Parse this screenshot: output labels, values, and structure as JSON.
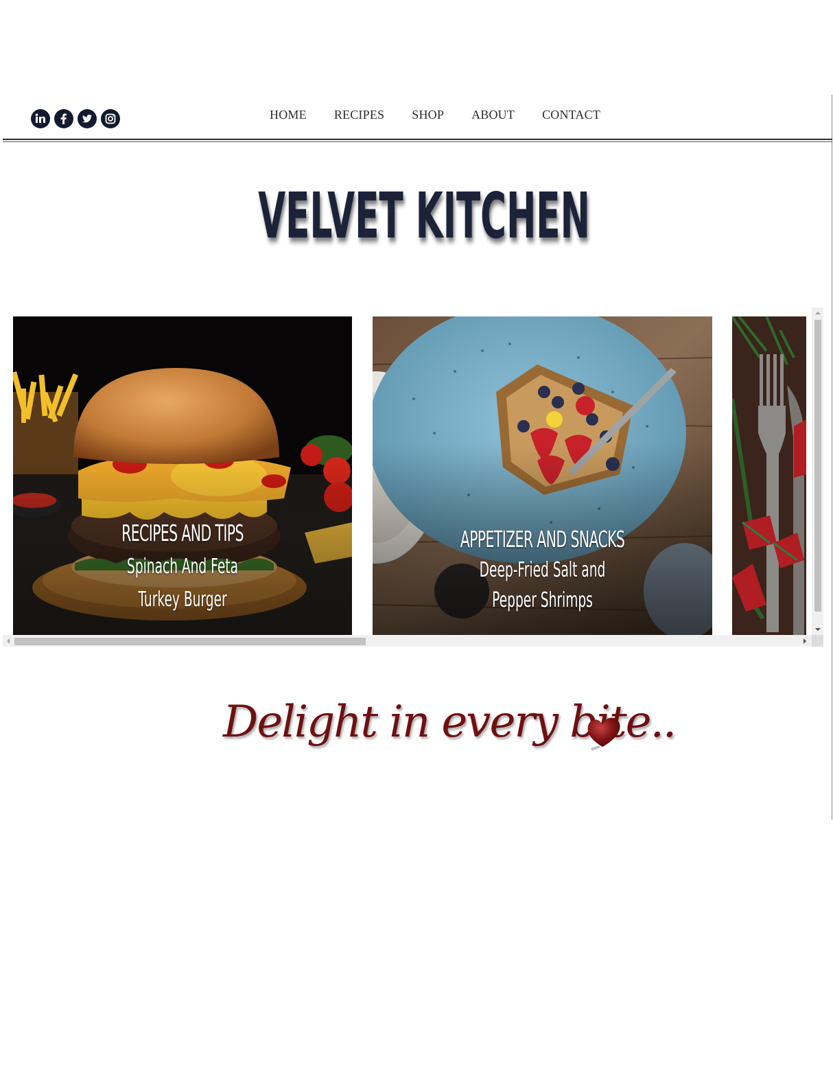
{
  "social": {
    "items": [
      {
        "name": "linkedin",
        "icon": "linkedin-icon"
      },
      {
        "name": "facebook",
        "icon": "facebook-icon"
      },
      {
        "name": "twitter",
        "icon": "twitter-icon"
      },
      {
        "name": "instagram",
        "icon": "instagram-icon"
      }
    ],
    "color": "#111a2e"
  },
  "nav": {
    "items": [
      "HOME",
      "RECIPES",
      "SHOP",
      "ABOUT",
      "CONTACT"
    ]
  },
  "logo": {
    "text": "VELVET KITCHEN",
    "color": "#1a2038"
  },
  "carousel": {
    "cards": [
      {
        "category": "RECIPES AND TIPS",
        "title_line1": "Spinach And Feta",
        "title_line2": "Turkey Burger"
      },
      {
        "category": "APPETIZER AND SNACKS",
        "title_line1": "Deep-Fried Salt and",
        "title_line2": "Pepper Shrimps"
      },
      {
        "category": "",
        "title_line1": "",
        "title_line2": ""
      }
    ]
  },
  "tagline": {
    "text": "Delight in every bite..",
    "color": "#6e1012"
  }
}
